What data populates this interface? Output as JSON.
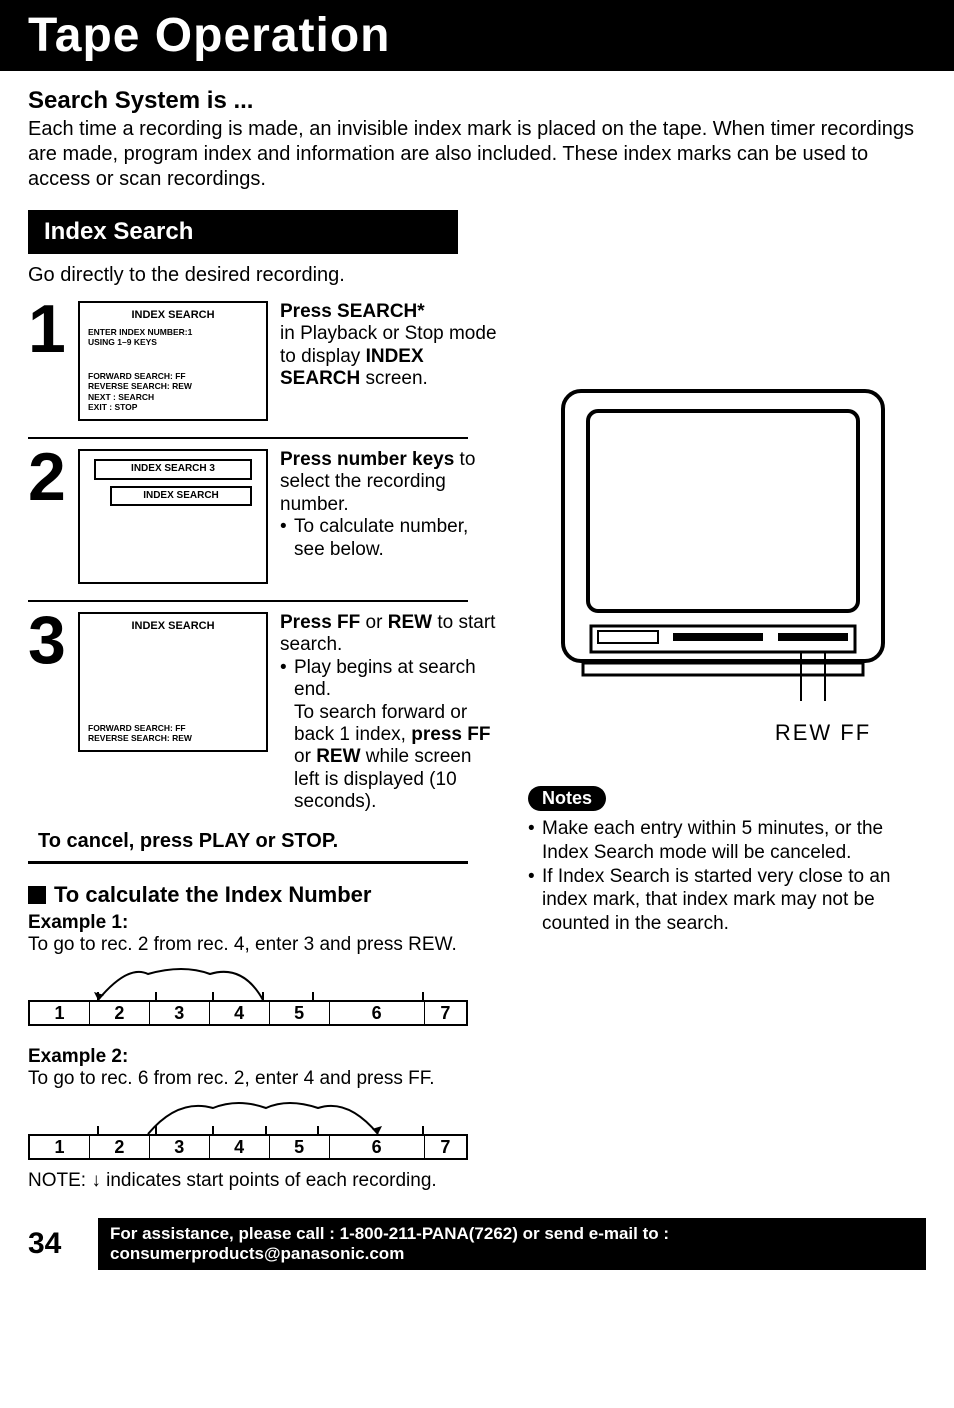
{
  "title": "Tape Operation",
  "intro": {
    "heading": "Search System is ...",
    "body": "Each time a recording is made, an invisible index mark is placed on the tape. When timer recordings are made, program index and information are also included. These index marks can be used to access or scan recordings."
  },
  "section_title": "Index Search",
  "section_intro": "Go directly to the desired recording.",
  "steps": [
    {
      "num": "1",
      "screen": {
        "title": "INDEX SEARCH",
        "line1": "ENTER INDEX NUMBER:1",
        "line2": "USING 1–9 KEYS",
        "line3": "FORWARD SEARCH: FF",
        "line4": "REVERSE SEARCH: REW",
        "line5": "NEXT : SEARCH",
        "line6": "EXIT : STOP"
      },
      "text_bold1": "Press SEARCH*",
      "text_rest": "in Playback or Stop mode to display",
      "text_bold2": " INDEX SEARCH ",
      "text_rest2": "screen."
    },
    {
      "num": "2",
      "screen": {
        "title": "INDEX SEARCH 3",
        "inner": "INDEX SEARCH"
      },
      "text_bold1": "Press number keys",
      "text_rest": " to select the recording number.",
      "bullet": "To calculate number, see below."
    },
    {
      "num": "3",
      "screen": {
        "title": "INDEX SEARCH",
        "line1": "FORWARD SEARCH: FF",
        "line2": "REVERSE SEARCH: REW"
      },
      "text_bold1": "Press FF ",
      "text_plain1": "or",
      "text_bold1b": " REW",
      "text_rest": " to start search.",
      "bullet1": "Play begins at search end.",
      "bullet2a": "To search forward or back 1 index, ",
      "bullet2b": "press FF",
      "bullet2c": " or ",
      "bullet2d": "REW",
      "bullet2e": " while screen left is displayed (10 seconds)."
    }
  ],
  "cancel_line": "To cancel, press PLAY or STOP.",
  "calc": {
    "heading": "To calculate the Index Number",
    "ex1_label": "Example 1:",
    "ex1_desc": "To go to rec. 2 from rec. 4, enter 3 and press REW.",
    "ex2_label": "Example 2:",
    "ex2_desc": "To go to rec. 6 from rec. 2, enter 4 and press FF.",
    "cells": [
      "1",
      "2",
      "3",
      "4",
      "5",
      "6",
      "7"
    ],
    "note": "NOTE: ↓ indicates start points of each recording."
  },
  "rewff": "REW  FF",
  "notes_label": "Notes",
  "notes": [
    "Make each entry within 5 minutes, or the Index Search mode will be canceled.",
    "If Index Search is started very close to an index mark, that index mark may not be counted in the search."
  ],
  "page_number": "34",
  "assist": "For assistance, please call : 1-800-211-PANA(7262) or send e-mail to : consumerproducts@panasonic.com"
}
